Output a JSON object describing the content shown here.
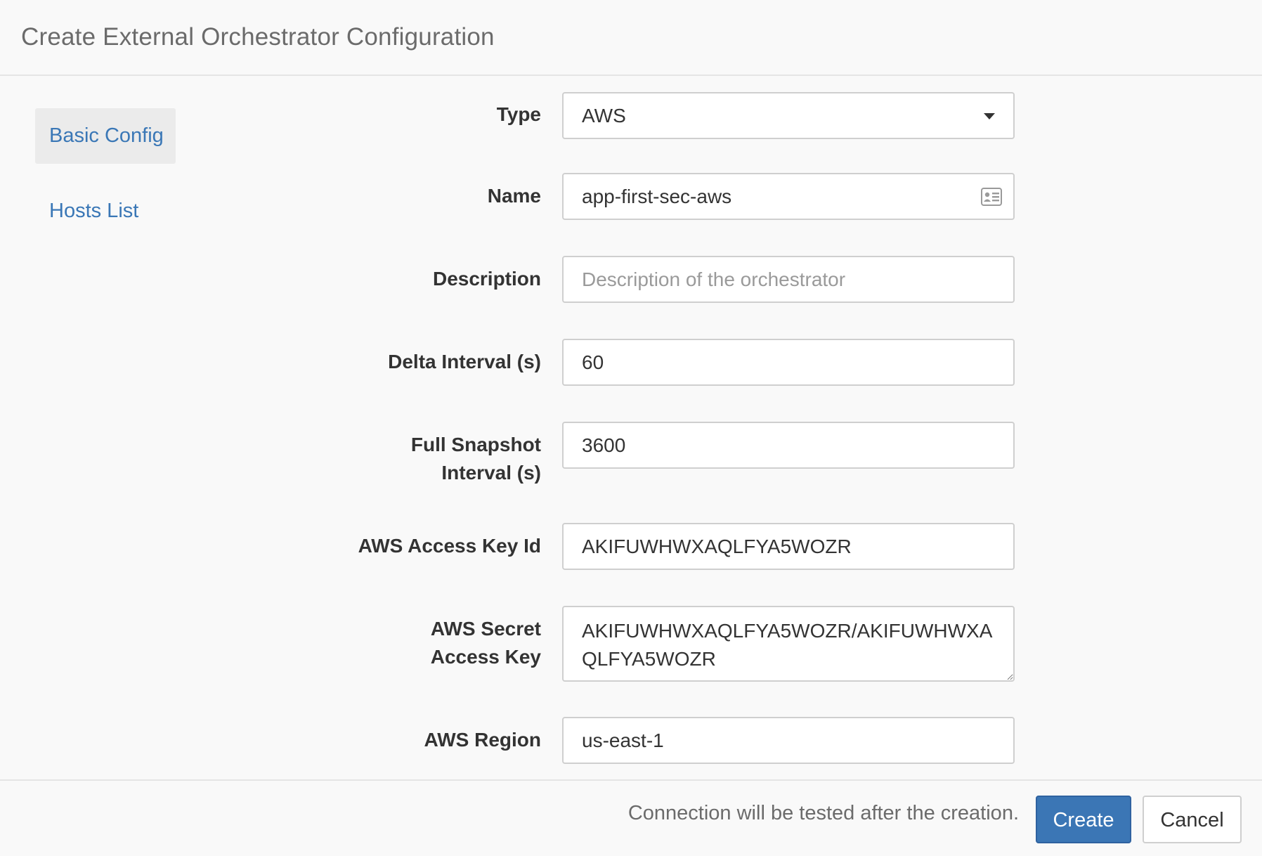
{
  "header": {
    "title": "Create External Orchestrator Configuration"
  },
  "sidenav": {
    "items": [
      {
        "label": "Basic Config",
        "active": true
      },
      {
        "label": "Hosts List",
        "active": false
      }
    ]
  },
  "form": {
    "type": {
      "label": "Type",
      "value": "AWS"
    },
    "name": {
      "label": "Name",
      "value": "app-first-sec-aws",
      "icon": "contact-card-icon"
    },
    "description": {
      "label": "Description",
      "value": "",
      "placeholder": "Description of the orchestrator"
    },
    "delta_interval": {
      "label": "Delta Interval (s)",
      "value": "60"
    },
    "full_snapshot": {
      "label_line1": "Full Snapshot",
      "label_line2": "Interval (s)",
      "value": "3600"
    },
    "access_key_id": {
      "label": "AWS Access Key Id",
      "value": "AKIFUWHWXAQLFYA5WOZR"
    },
    "secret_key": {
      "label_line1": "AWS Secret",
      "label_line2": "Access Key",
      "value": "AKIFUWHWXAQLFYA5WOZR/AKIFUWHWXAQLFYA5WOZR"
    },
    "region": {
      "label": "AWS Region",
      "value": "us-east-1"
    }
  },
  "footer": {
    "note": "Connection will be tested after the creation.",
    "create_label": "Create",
    "cancel_label": "Cancel"
  },
  "colors": {
    "primary": "#3b76b5",
    "link": "#3a77b6",
    "active_nav_bg": "#ebebeb"
  }
}
